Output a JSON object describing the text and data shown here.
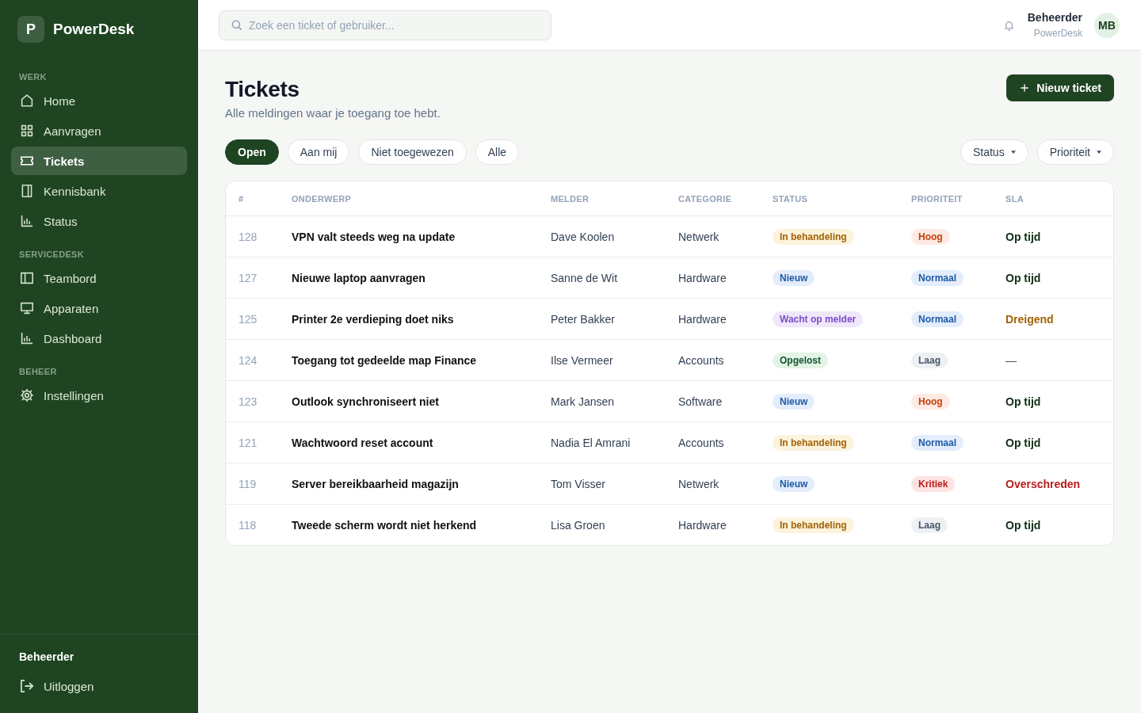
{
  "sidebar": {
    "logo": {
      "mark": "P",
      "name": "PowerDesk"
    },
    "sections": [
      {
        "title": "WERK",
        "items": [
          {
            "label": "Home",
            "selected": false
          },
          {
            "label": "Aanvragen",
            "selected": false
          },
          {
            "label": "Tickets",
            "selected": true
          },
          {
            "label": "Kennisbank",
            "selected": false
          },
          {
            "label": "Status",
            "selected": false
          }
        ]
      },
      {
        "title": "SERVICEDESK",
        "items": [
          {
            "label": "Teambord",
            "selected": false
          },
          {
            "label": "Apparaten",
            "selected": false
          },
          {
            "label": "Dashboard",
            "selected": false
          }
        ]
      },
      {
        "title": "BEHEER",
        "items": [
          {
            "label": "Instellingen",
            "selected": false
          }
        ]
      }
    ],
    "footer": {
      "user": "Beheerder",
      "logout": "Uitloggen"
    }
  },
  "header": {
    "search": {
      "placeholder": "Zoek een ticket of gebruiker..."
    },
    "user": {
      "name": "Beheerder",
      "org": "PowerDesk",
      "initials": "MB"
    }
  },
  "page": {
    "title": "Tickets",
    "subtitle": "Alle meldingen waar je toegang toe hebt.",
    "new_button": "Nieuw ticket"
  },
  "filters": [
    {
      "label": "Open",
      "selected": true
    },
    {
      "label": "Aan mij",
      "selected": false
    },
    {
      "label": "Niet toegewezen",
      "selected": false
    },
    {
      "label": "Alle",
      "selected": false
    }
  ],
  "dropdowns": [
    "Status",
    "Prioriteit"
  ],
  "table": {
    "columns": [
      "#",
      "ONDERWERP",
      "MELDER",
      "CATEGORIE",
      "STATUS",
      "PRIORITEIT",
      "SLA"
    ],
    "rows": [
      {
        "id": "128",
        "subject": "VPN valt steeds weg na update",
        "reporter": "Dave Koolen",
        "category": "Netwerk",
        "status": {
          "label": "In behandeling",
          "kind": "progress"
        },
        "priority": {
          "label": "Hoog",
          "kind": "high"
        },
        "sla": {
          "label": "Op tijd",
          "kind": "on_time"
        }
      },
      {
        "id": "127",
        "subject": "Nieuwe laptop aanvragen",
        "reporter": "Sanne de Wit",
        "category": "Hardware",
        "status": {
          "label": "Nieuw",
          "kind": "new"
        },
        "priority": {
          "label": "Normaal",
          "kind": "normal"
        },
        "sla": {
          "label": "Op tijd",
          "kind": "on_time"
        }
      },
      {
        "id": "125",
        "subject": "Printer 2e verdieping doet niks",
        "reporter": "Peter Bakker",
        "category": "Hardware",
        "status": {
          "label": "Wacht op melder",
          "kind": "waiting"
        },
        "priority": {
          "label": "Normaal",
          "kind": "normal"
        },
        "sla": {
          "label": "Dreigend",
          "kind": "at_risk"
        }
      },
      {
        "id": "124",
        "subject": "Toegang tot gedeelde map Finance",
        "reporter": "Ilse Vermeer",
        "category": "Accounts",
        "status": {
          "label": "Opgelost",
          "kind": "resolved"
        },
        "priority": {
          "label": "Laag",
          "kind": "low"
        },
        "sla": {
          "label": "—",
          "kind": "none"
        }
      },
      {
        "id": "123",
        "subject": "Outlook synchroniseert niet",
        "reporter": "Mark Jansen",
        "category": "Software",
        "status": {
          "label": "Nieuw",
          "kind": "new"
        },
        "priority": {
          "label": "Hoog",
          "kind": "high"
        },
        "sla": {
          "label": "Op tijd",
          "kind": "on_time"
        }
      },
      {
        "id": "121",
        "subject": "Wachtwoord reset account",
        "reporter": "Nadia El Amrani",
        "category": "Accounts",
        "status": {
          "label": "In behandeling",
          "kind": "progress"
        },
        "priority": {
          "label": "Normaal",
          "kind": "normal"
        },
        "sla": {
          "label": "Op tijd",
          "kind": "on_time"
        }
      },
      {
        "id": "119",
        "subject": "Server bereikbaarheid magazijn",
        "reporter": "Tom Visser",
        "category": "Netwerk",
        "status": {
          "label": "Nieuw",
          "kind": "new"
        },
        "priority": {
          "label": "Kritiek",
          "kind": "critical"
        },
        "sla": {
          "label": "Overschreden",
          "kind": "breached"
        }
      },
      {
        "id": "118",
        "subject": "Tweede scherm wordt niet herkend",
        "reporter": "Lisa Groen",
        "category": "Hardware",
        "status": {
          "label": "In behandeling",
          "kind": "progress"
        },
        "priority": {
          "label": "Laag",
          "kind": "low"
        },
        "sla": {
          "label": "Op tijd",
          "kind": "on_time"
        }
      }
    ]
  }
}
